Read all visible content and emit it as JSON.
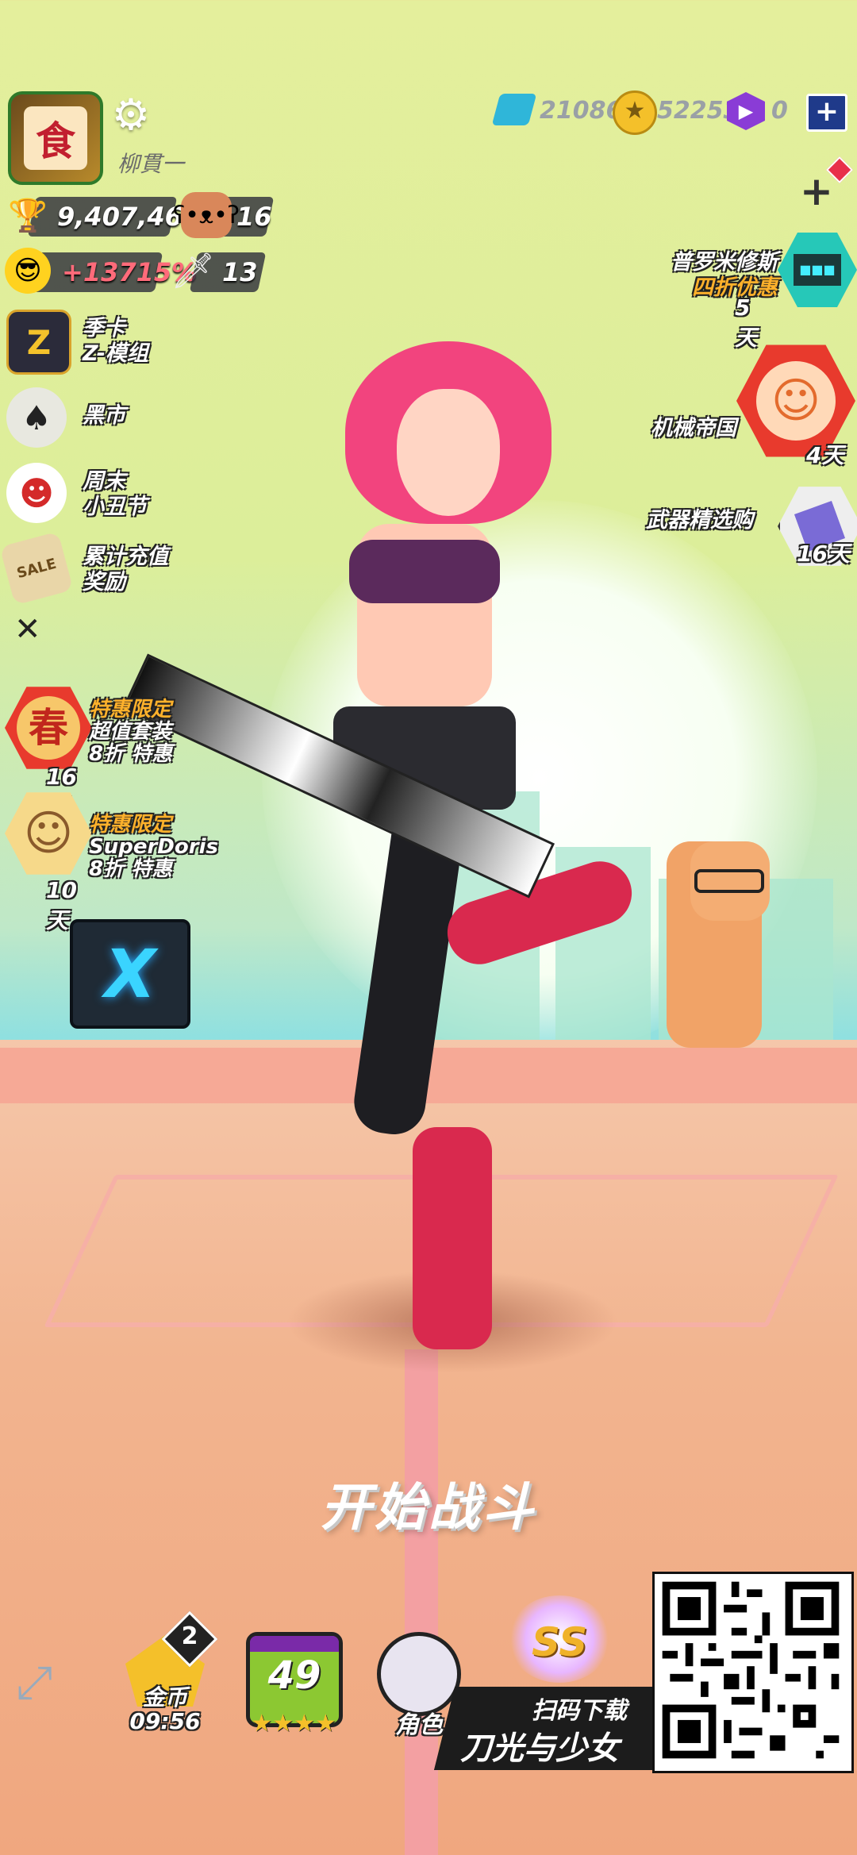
{
  "player": {
    "name": "柳貫一",
    "avatar_glyph": "食"
  },
  "stats": {
    "trophies": "9,407,463",
    "bear_count": "16",
    "bonus": "+13715%",
    "sword_count": "13"
  },
  "currency": {
    "gems": "21086",
    "coins": "52253",
    "tickets": "0",
    "add_label": "+"
  },
  "left_menu": [
    {
      "icon": "z-card-icon",
      "glyph": "Z",
      "line1": "季卡",
      "line2": "Z-模组"
    },
    {
      "icon": "spade-icon",
      "glyph": "♠",
      "line1": "黑市",
      "line2": ""
    },
    {
      "icon": "clown-icon",
      "glyph": "☻",
      "line1": "周末",
      "line2": "小丑节"
    },
    {
      "icon": "sale-tag-icon",
      "glyph": "SALE",
      "line1": "累计充值",
      "line2": "奖励"
    }
  ],
  "left_promos": [
    {
      "icon": "spring-icon",
      "glyph": "春",
      "line1": "特惠限定",
      "line2": "超值套装",
      "line3": "8折 特惠",
      "days": "16天"
    },
    {
      "icon": "hero-portrait-icon",
      "glyph": "☺",
      "line1": "特惠限定",
      "line2": "SuperDoris",
      "line3": "8折 特惠",
      "days": "10天"
    }
  ],
  "right_promos": [
    {
      "icon": "robot-portrait-icon",
      "line1": "普罗米修斯",
      "line2": "四折优惠",
      "days": "5天"
    },
    {
      "icon": "mech-empire-portrait-icon",
      "line1": "机械帝国",
      "line2": "",
      "days": "4天"
    },
    {
      "icon": "weapon-shop-icon",
      "line1": "武器精选购",
      "line2": "",
      "days": "16天"
    }
  ],
  "x_badge": "X",
  "close_glyph": "✕",
  "start_battle": "开始战斗",
  "bottom": {
    "gold_label": "金币",
    "gold_timer": "09:56",
    "gold_badge": "2",
    "level": "49",
    "stars": "★★★★",
    "role_label": "角色",
    "rank": "SS"
  },
  "qr": {
    "line1": "扫码下载",
    "line2": "刀光与少女"
  },
  "colors": {
    "accent_red": "#e83a2d",
    "bonus_text": "#ff6b7a",
    "promo_orange": "#ffb12b",
    "level_green": "#9bd43a"
  }
}
